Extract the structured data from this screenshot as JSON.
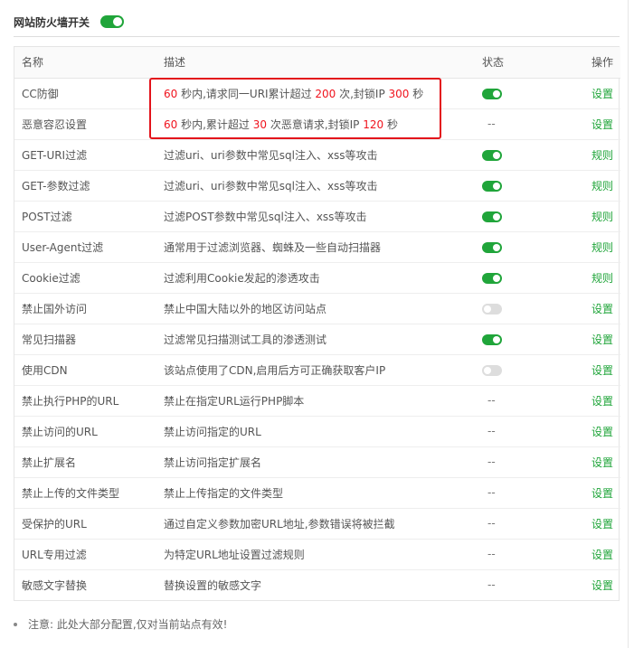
{
  "header": {
    "title": "网站防火墙开关",
    "enabled": true
  },
  "table": {
    "columns": [
      "名称",
      "描述",
      "状态",
      "操作"
    ],
    "rows": [
      {
        "name": "CC防御",
        "desc": [
          {
            "t": "60",
            "n": true
          },
          {
            "t": " 秒内,请求同一URI累计超过 "
          },
          {
            "t": "200",
            "n": true
          },
          {
            "t": " 次,封锁IP "
          },
          {
            "t": "300",
            "n": true
          },
          {
            "t": " 秒"
          }
        ],
        "status": "on",
        "action": "设置"
      },
      {
        "name": "恶意容忍设置",
        "desc": [
          {
            "t": "60",
            "n": true
          },
          {
            "t": " 秒内,累计超过 "
          },
          {
            "t": "30",
            "n": true
          },
          {
            "t": " 次恶意请求,封锁IP "
          },
          {
            "t": "120",
            "n": true
          },
          {
            "t": " 秒"
          }
        ],
        "status": "--",
        "action": "设置"
      },
      {
        "name": "GET-URI过滤",
        "desc": [
          {
            "t": "过滤uri、uri参数中常见sql注入、xss等攻击"
          }
        ],
        "status": "on",
        "action": "规则"
      },
      {
        "name": "GET-参数过滤",
        "desc": [
          {
            "t": "过滤uri、uri参数中常见sql注入、xss等攻击"
          }
        ],
        "status": "on",
        "action": "规则"
      },
      {
        "name": "POST过滤",
        "desc": [
          {
            "t": "过滤POST参数中常见sql注入、xss等攻击"
          }
        ],
        "status": "on",
        "action": "规则"
      },
      {
        "name": "User-Agent过滤",
        "desc": [
          {
            "t": "通常用于过滤浏览器、蜘蛛及一些自动扫描器"
          }
        ],
        "status": "on",
        "action": "规则"
      },
      {
        "name": "Cookie过滤",
        "desc": [
          {
            "t": "过滤利用Cookie发起的渗透攻击"
          }
        ],
        "status": "on",
        "action": "规则"
      },
      {
        "name": "禁止国外访问",
        "desc": [
          {
            "t": "禁止中国大陆以外的地区访问站点"
          }
        ],
        "status": "off",
        "action": "设置"
      },
      {
        "name": "常见扫描器",
        "desc": [
          {
            "t": "过滤常见扫描测试工具的渗透测试"
          }
        ],
        "status": "on",
        "action": "设置"
      },
      {
        "name": "使用CDN",
        "desc": [
          {
            "t": "该站点使用了CDN,启用后方可正确获取客户IP"
          }
        ],
        "status": "off",
        "action": "设置"
      },
      {
        "name": "禁止执行PHP的URL",
        "desc": [
          {
            "t": "禁止在指定URL运行PHP脚本"
          }
        ],
        "status": "--",
        "action": "设置"
      },
      {
        "name": "禁止访问的URL",
        "desc": [
          {
            "t": "禁止访问指定的URL"
          }
        ],
        "status": "--",
        "action": "设置"
      },
      {
        "name": "禁止扩展名",
        "desc": [
          {
            "t": "禁止访问指定扩展名"
          }
        ],
        "status": "--",
        "action": "设置"
      },
      {
        "name": "禁止上传的文件类型",
        "desc": [
          {
            "t": "禁止上传指定的文件类型"
          }
        ],
        "status": "--",
        "action": "设置"
      },
      {
        "name": "受保护的URL",
        "desc": [
          {
            "t": "通过自定义参数加密URL地址,参数错误将被拦截"
          }
        ],
        "status": "--",
        "action": "设置"
      },
      {
        "name": "URL专用过滤",
        "desc": [
          {
            "t": "为特定URL地址设置过滤规则"
          }
        ],
        "status": "--",
        "action": "设置"
      },
      {
        "name": "敏感文字替换",
        "desc": [
          {
            "t": "替换设置的敏感文字"
          }
        ],
        "status": "--",
        "action": "设置"
      }
    ]
  },
  "note": "注意: 此处大部分配置,仅对当前站点有效!",
  "colors": {
    "accent": "#20a53a",
    "number": "#f0141e",
    "highlight": "#e3131b"
  }
}
